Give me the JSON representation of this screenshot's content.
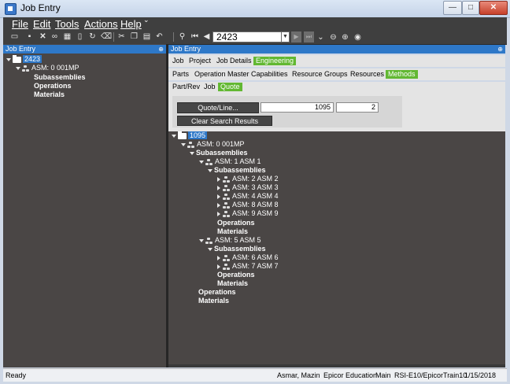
{
  "window": {
    "title": "Job Entry",
    "controls": {
      "minimize": "—",
      "maximize": "□",
      "close": "✕"
    }
  },
  "menu": [
    "File",
    "Edit",
    "Tools",
    "Actions",
    "Help"
  ],
  "menu_overflow": "⌄",
  "toolbar": {
    "key_value": "2423",
    "icons": [
      "new-icon",
      "save-icon",
      "delete-icon",
      "binoculars-icon",
      "grid-icon",
      "clipboard-icon",
      "refresh-icon",
      "clear-icon",
      "cut-icon",
      "copy-icon",
      "paste-icon",
      "undo-icon",
      "search-icon",
      "first-record-icon",
      "prev-record-icon",
      "next-record-icon",
      "last-record-icon",
      "back-icon",
      "forward-icon",
      "home-icon"
    ]
  },
  "left_panel": {
    "header": "Job Entry",
    "pin": "⊕",
    "tree": {
      "root": "2423",
      "asm": "ASM: 0 001MP",
      "children": [
        "Subassemblies",
        "Operations",
        "Materials"
      ]
    }
  },
  "right_panel": {
    "header": "Job Entry",
    "pin": "⊕",
    "tabs_row1": [
      "Job",
      "Project",
      "Job Details",
      "Engineering"
    ],
    "tabs_row2": [
      "Parts",
      "Operation Master",
      "Capabilities",
      "Resource Groups",
      "Resources",
      "Methods"
    ],
    "tabs_row3": [
      "Part/Rev",
      "Job",
      "Quote"
    ],
    "quote_button": "Quote/Line...",
    "quote_num": "1095",
    "quote_line": "2",
    "clear_button": "Clear Search Results",
    "tree": {
      "root": "1095",
      "asm0": "ASM: 0 001MP",
      "sub0": "Subassemblies",
      "asm1": "ASM: 1 ASM 1",
      "sub1": "Subassemblies",
      "asm1_children": [
        "ASM: 2 ASM 2",
        "ASM: 3 ASM 3",
        "ASM: 4 ASM 4",
        "ASM: 8 ASM 8",
        "ASM: 9 ASM 9"
      ],
      "asm1_ops": "Operations",
      "asm1_mats": "Materials",
      "asm5": "ASM: 5 ASM 5",
      "sub5": "Subassemblies",
      "asm5_children": [
        "ASM: 6 ASM 6",
        "ASM: 7 ASM 7"
      ],
      "asm5_ops": "Operations",
      "asm5_mats": "Materials",
      "ops0": "Operations",
      "mats0": "Materials"
    }
  },
  "status": {
    "ready": "Ready",
    "user": "Asmar, Mazin",
    "company": "Epicor Education",
    "site": "Main",
    "server": "RSI-E10/EpicorTrain10",
    "date": "1/15/2018"
  }
}
